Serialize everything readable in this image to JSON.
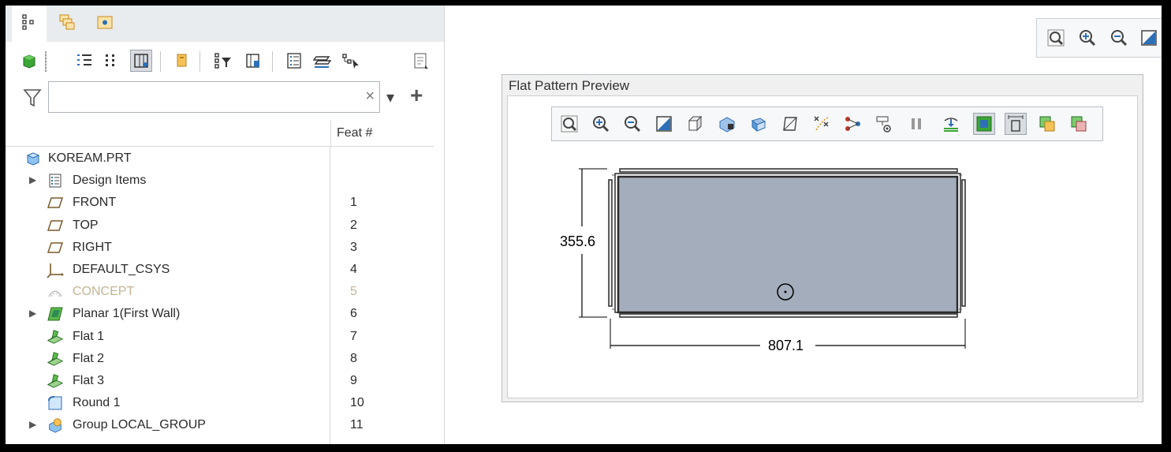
{
  "left_panel": {
    "tabs": [
      {
        "icon": "model-tree-icon"
      },
      {
        "icon": "layer-tree-icon"
      },
      {
        "icon": "folder-browser-icon"
      }
    ],
    "filter": {
      "placeholder": "",
      "value": "",
      "clear_glyph": "×",
      "dropdown_glyph": "▾",
      "add_glyph": "+"
    },
    "column_header": "Feat #",
    "tree": [
      {
        "label": "KOREAM.PRT",
        "num": "",
        "icon": "part-icon",
        "expandable": false,
        "dim": false
      },
      {
        "label": "Design Items",
        "num": "",
        "icon": "design-items-icon",
        "expandable": true,
        "dim": false
      },
      {
        "label": "FRONT",
        "num": "1",
        "icon": "datum-plane-icon",
        "expandable": false,
        "dim": false
      },
      {
        "label": "TOP",
        "num": "2",
        "icon": "datum-plane-icon",
        "expandable": false,
        "dim": false
      },
      {
        "label": "RIGHT",
        "num": "3",
        "icon": "datum-plane-icon",
        "expandable": false,
        "dim": false
      },
      {
        "label": "DEFAULT_CSYS",
        "num": "4",
        "icon": "csys-icon",
        "expandable": false,
        "dim": false
      },
      {
        "label": "CONCEPT",
        "num": "5",
        "icon": "concept-icon",
        "expandable": false,
        "dim": true
      },
      {
        "label": "Planar 1(First Wall)",
        "num": "6",
        "icon": "planar-wall-icon",
        "expandable": true,
        "dim": false
      },
      {
        "label": "Flat 1",
        "num": "7",
        "icon": "flat-wall-icon",
        "expandable": false,
        "dim": false
      },
      {
        "label": "Flat 2",
        "num": "8",
        "icon": "flat-wall-icon",
        "expandable": false,
        "dim": false
      },
      {
        "label": "Flat 3",
        "num": "9",
        "icon": "flat-wall-icon",
        "expandable": false,
        "dim": false
      },
      {
        "label": "Round 1",
        "num": "10",
        "icon": "round-icon",
        "expandable": false,
        "dim": false
      },
      {
        "label": "Group LOCAL_GROUP",
        "num": "11",
        "icon": "group-icon",
        "expandable": true,
        "dim": false
      }
    ]
  },
  "flat_pattern": {
    "title": "Flat Pattern Preview",
    "dim_height": "355.6",
    "dim_width": "807.1"
  },
  "colors": {
    "plate_fill": "#a3adbb",
    "plate_edge": "#2b2b2b",
    "icon_blue": "#2c6fb7",
    "icon_green": "#3aa635",
    "icon_orange": "#d98b1e",
    "datum_brown": "#7a5a2a"
  }
}
